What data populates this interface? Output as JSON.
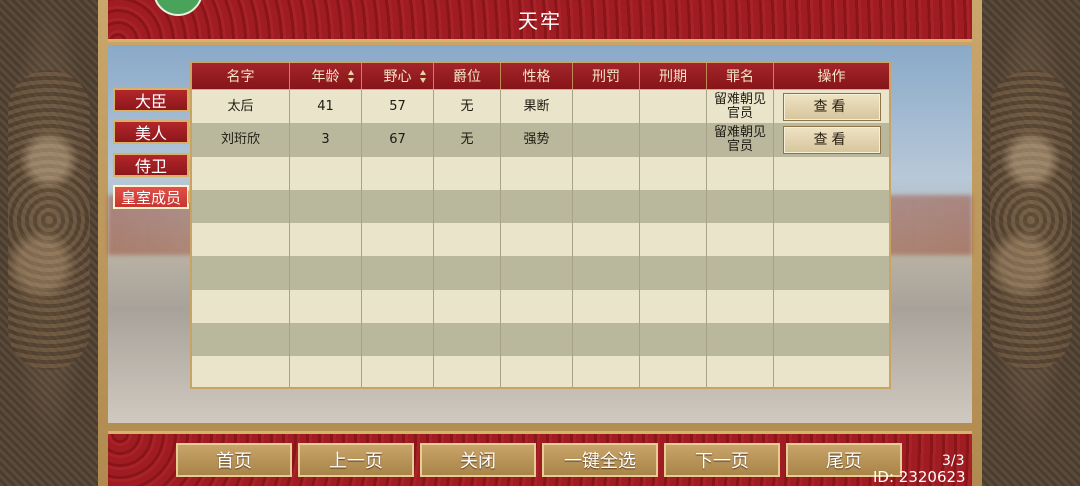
{
  "title": "天牢",
  "categories": [
    {
      "label": "大臣",
      "active": false
    },
    {
      "label": "美人",
      "active": false
    },
    {
      "label": "侍卫",
      "active": false
    },
    {
      "label": "皇室成员",
      "active": true
    }
  ],
  "table": {
    "headers": [
      "名字",
      "年龄",
      "野心",
      "爵位",
      "性格",
      "刑罚",
      "刑期",
      "罪名",
      "操作"
    ],
    "sortable": [
      false,
      true,
      true,
      false,
      false,
      false,
      false,
      false,
      false
    ],
    "rows": [
      {
        "name": "太后",
        "age": "41",
        "ambition": "57",
        "rank": "无",
        "personality": "果断",
        "punishment": "",
        "term": "",
        "crime": "留难朝见官员",
        "action": "查看"
      },
      {
        "name": "刘珩欣",
        "age": "3",
        "ambition": "67",
        "rank": "无",
        "personality": "强势",
        "punishment": "",
        "term": "",
        "crime": "留难朝见官员",
        "action": "查看"
      }
    ],
    "empty_rows": 7
  },
  "nav": {
    "first": "首页",
    "prev": "上一页",
    "close": "关闭",
    "select_all": "一键全选",
    "next": "下一页",
    "last": "尾页"
  },
  "page_indicator": "3/3",
  "player_id": "ID: 2320623",
  "colors": {
    "header_red": "#9a1a20",
    "gold": "#c9a66b",
    "row_light": "#eae5ca",
    "row_dark": "#b9b79c",
    "active_tab": "#d8403b"
  }
}
